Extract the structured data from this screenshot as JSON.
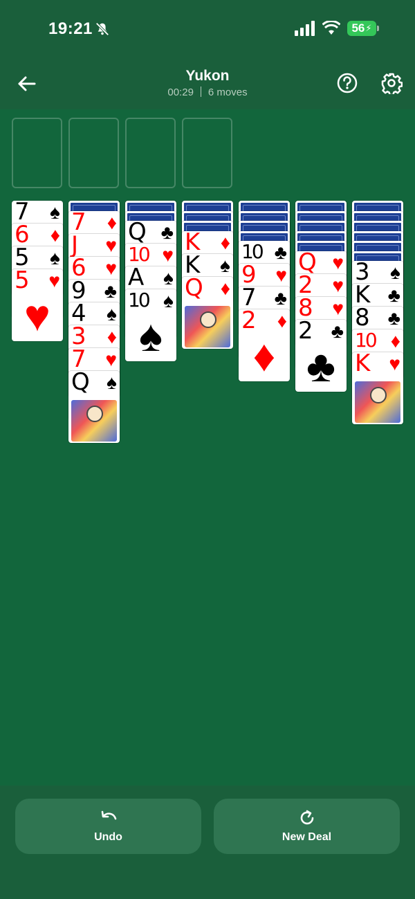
{
  "status": {
    "time": "19:21",
    "battery": "56"
  },
  "header": {
    "title": "Yukon",
    "timer": "00:29",
    "moves": "6 moves"
  },
  "buttons": {
    "undo": "Undo",
    "new_deal": "New Deal"
  },
  "colors": {
    "felt": "#12663c",
    "bar": "#1a5f3b",
    "button": "#2f7551",
    "card_back": "#1d3f94",
    "red": "#ff0000",
    "black": "#000000"
  },
  "icons": {
    "back": "arrow-left-icon",
    "help": "question-circle-icon",
    "settings": "gear-icon",
    "undo": "undo-arrow-icon",
    "new_deal": "refresh-icon"
  },
  "tableau": [
    {
      "facedown": 0,
      "cards": [
        {
          "rank": "7",
          "suit": "♠"
        },
        {
          "rank": "6",
          "suit": "♦"
        },
        {
          "rank": "5",
          "suit": "♠"
        },
        {
          "rank": "5",
          "suit": "♥"
        }
      ]
    },
    {
      "facedown": 1,
      "cards": [
        {
          "rank": "7",
          "suit": "♦"
        },
        {
          "rank": "J",
          "suit": "♥"
        },
        {
          "rank": "6",
          "suit": "♥"
        },
        {
          "rank": "9",
          "suit": "♣"
        },
        {
          "rank": "4",
          "suit": "♠"
        },
        {
          "rank": "3",
          "suit": "♦"
        },
        {
          "rank": "7",
          "suit": "♥"
        },
        {
          "rank": "Q",
          "suit": "♠"
        }
      ]
    },
    {
      "facedown": 2,
      "cards": [
        {
          "rank": "Q",
          "suit": "♣"
        },
        {
          "rank": "10",
          "suit": "♥"
        },
        {
          "rank": "A",
          "suit": "♠"
        },
        {
          "rank": "10",
          "suit": "♠"
        }
      ]
    },
    {
      "facedown": 3,
      "cards": [
        {
          "rank": "K",
          "suit": "♦"
        },
        {
          "rank": "K",
          "suit": "♠"
        },
        {
          "rank": "Q",
          "suit": "♦"
        }
      ]
    },
    {
      "facedown": 4,
      "cards": [
        {
          "rank": "10",
          "suit": "♣"
        },
        {
          "rank": "9",
          "suit": "♥"
        },
        {
          "rank": "7",
          "suit": "♣"
        },
        {
          "rank": "2",
          "suit": "♦"
        }
      ]
    },
    {
      "facedown": 5,
      "cards": [
        {
          "rank": "Q",
          "suit": "♥"
        },
        {
          "rank": "2",
          "suit": "♥"
        },
        {
          "rank": "8",
          "suit": "♥"
        },
        {
          "rank": "2",
          "suit": "♣"
        }
      ]
    },
    {
      "facedown": 6,
      "cards": [
        {
          "rank": "3",
          "suit": "♠"
        },
        {
          "rank": "K",
          "suit": "♣"
        },
        {
          "rank": "8",
          "suit": "♣"
        },
        {
          "rank": "10",
          "suit": "♦"
        },
        {
          "rank": "K",
          "suit": "♥"
        }
      ]
    }
  ]
}
